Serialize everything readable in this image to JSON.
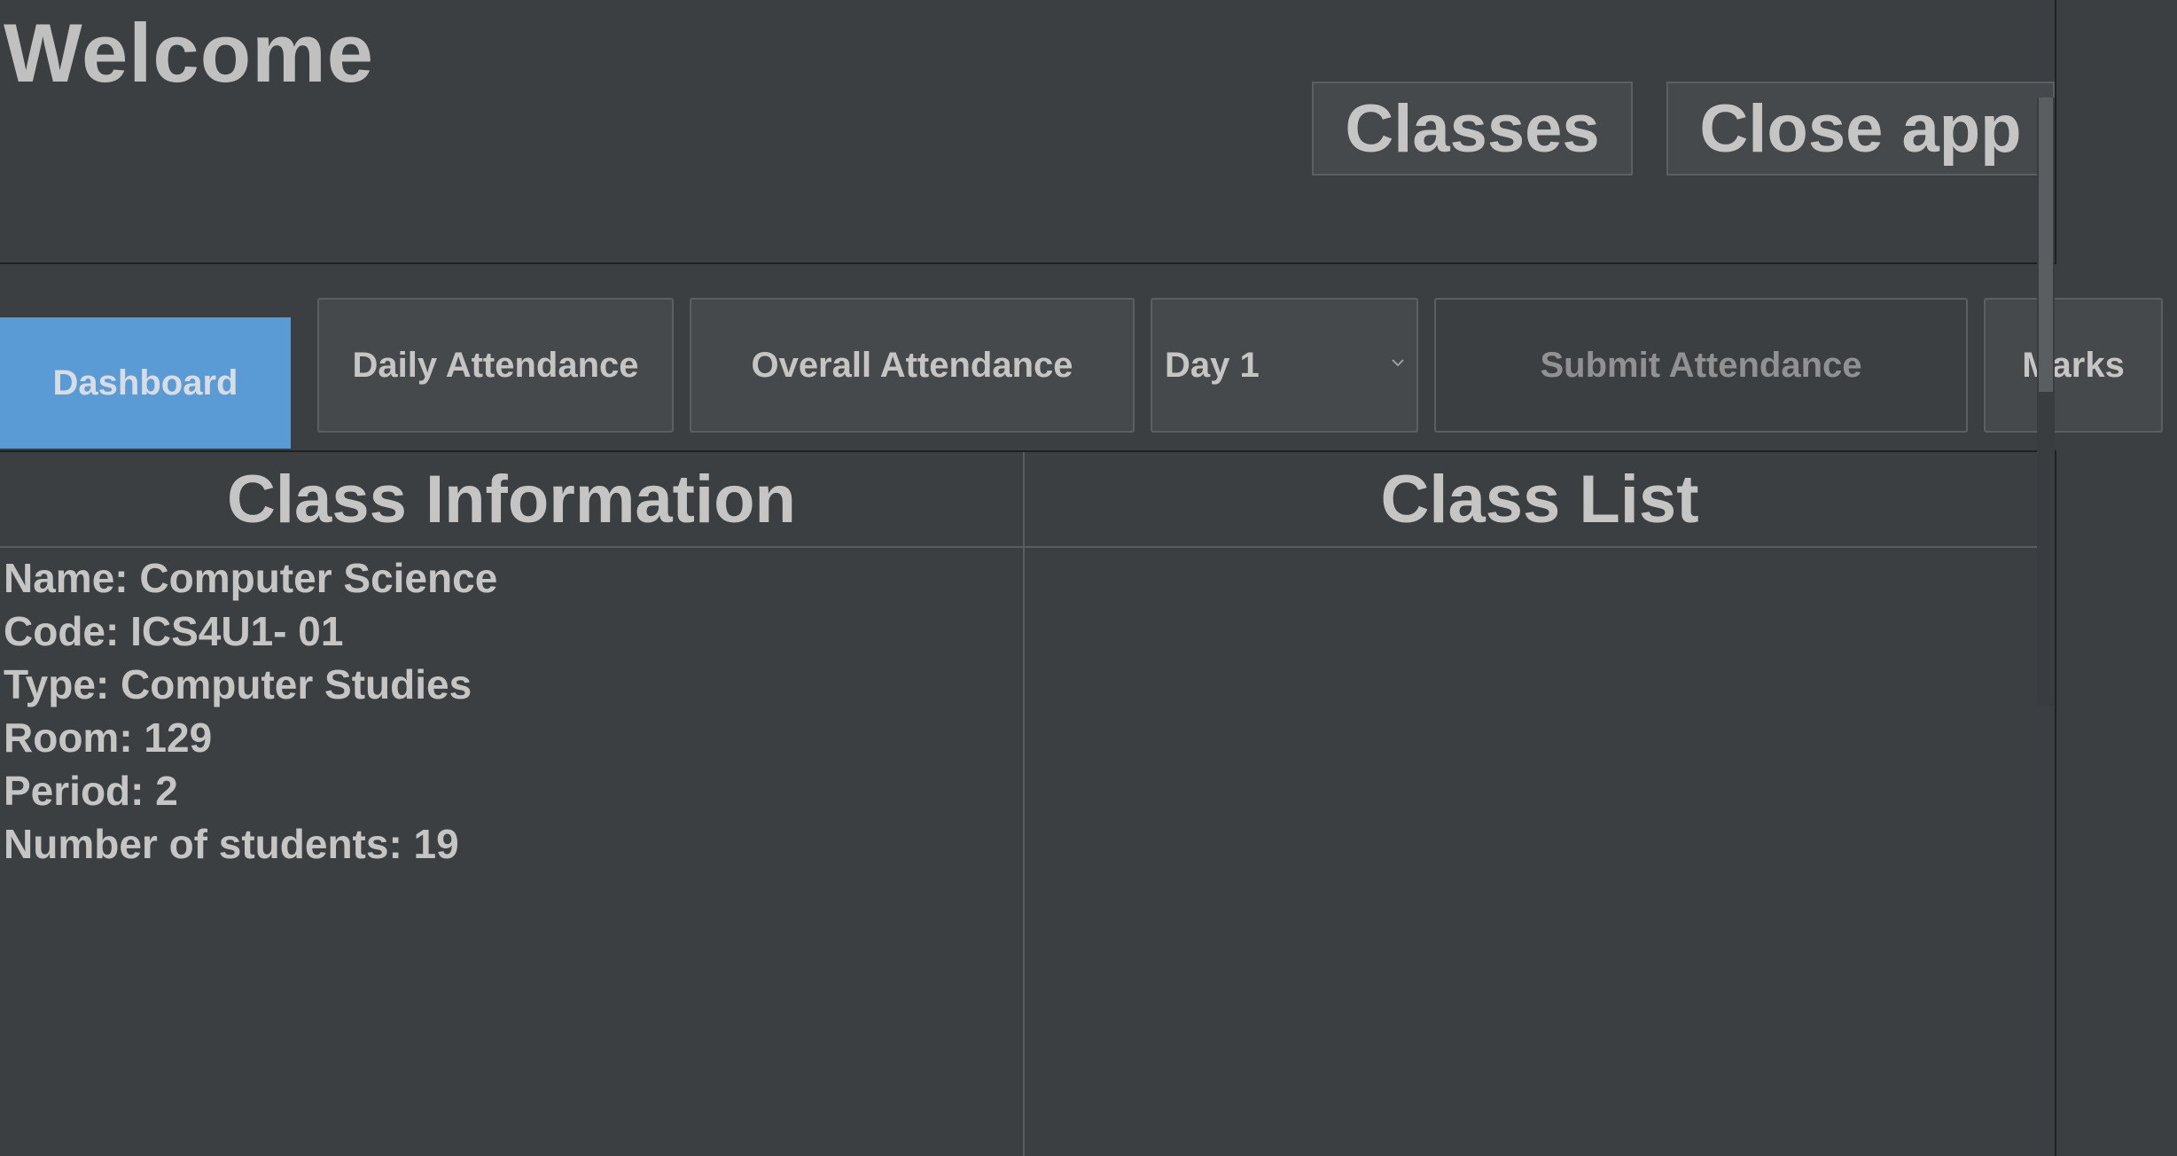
{
  "header": {
    "title": "Welcome",
    "buttons": {
      "classes": "Classes",
      "close_app": "Close app"
    }
  },
  "toolbar": {
    "dashboard": "Dashboard",
    "daily_attendance": "Daily Attendance",
    "overall_attendance": "Overall Attendance",
    "day_select": {
      "selected": "Day 1",
      "icon": "chevron-down-icon"
    },
    "submit_attendance": "Submit Attendance",
    "marks": "Marks",
    "active_tab": "Dashboard"
  },
  "class_info": {
    "title": "Class Information",
    "lines": [
      "Name: Computer Science",
      "Code: ICS4U1- 01",
      "Type: Computer Studies",
      "Room: 129",
      "Period: 2",
      "Number of students: 19"
    ]
  },
  "class_list": {
    "title": "Class List",
    "items": []
  },
  "colors": {
    "background": "#3c3f41",
    "button": "#46494b",
    "active_tab": "#5b9bd5",
    "text": "#c5c5c5",
    "disabled_text": "#8f9193"
  }
}
